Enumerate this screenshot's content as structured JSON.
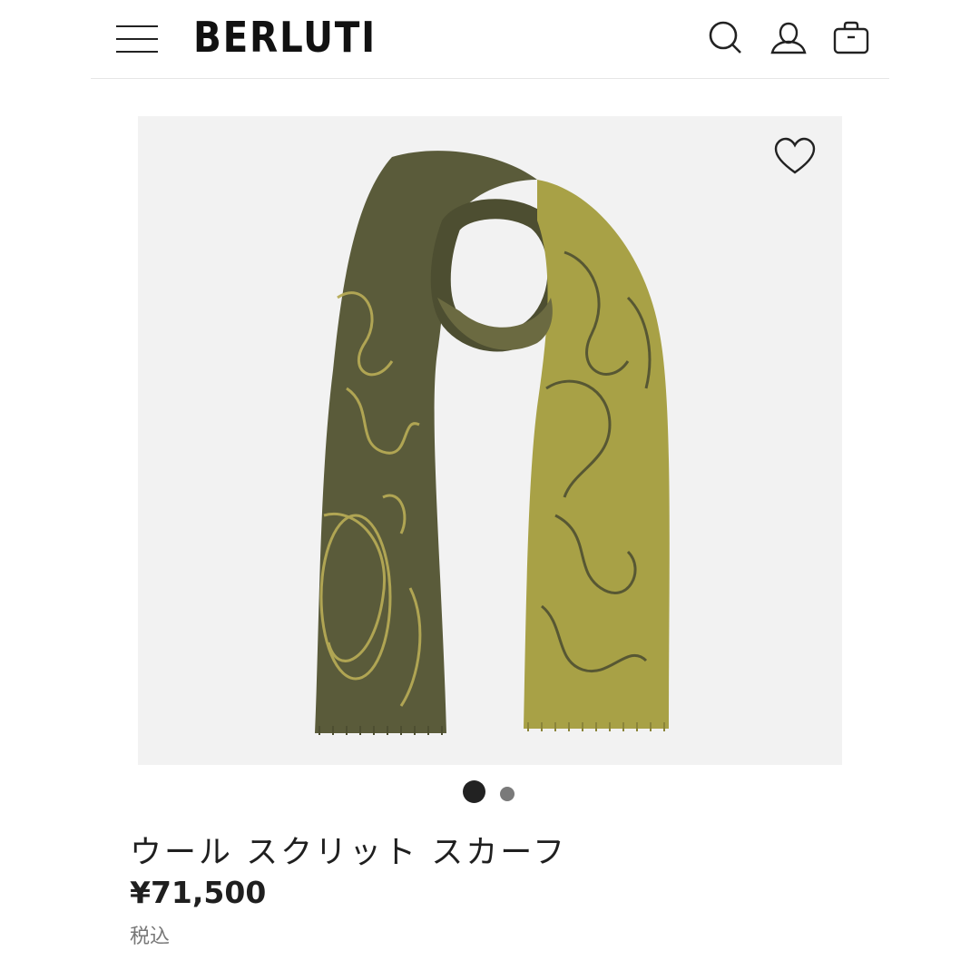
{
  "header": {
    "brand": "BERLUTI",
    "menu_icon": "hamburger-menu-icon",
    "search_icon": "search-icon",
    "account_icon": "user-icon",
    "bag_icon": "shopping-bag-icon"
  },
  "gallery": {
    "wishlist_icon": "heart-icon",
    "slides_total": 2,
    "active_slide": 1
  },
  "product": {
    "name": "ウール スクリット スカーフ",
    "price": "¥71,500",
    "tax_note": "税込"
  },
  "colors": {
    "scarf_dark": "#5a5b3a",
    "scarf_light": "#a8a146",
    "image_bg": "#f2f2f2"
  }
}
